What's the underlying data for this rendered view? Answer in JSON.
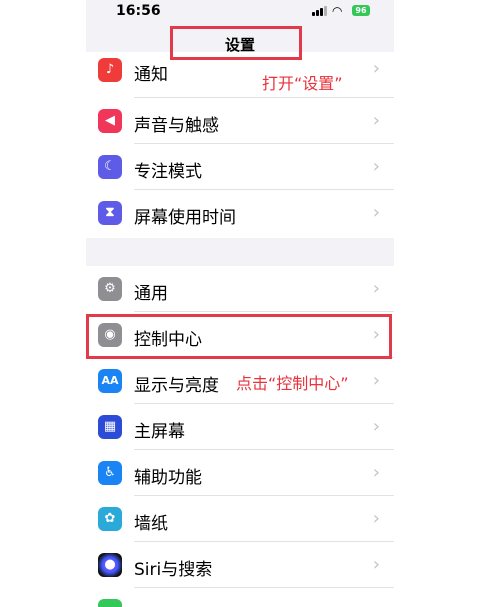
{
  "status_bar": {
    "time": "16:56",
    "battery": "96"
  },
  "nav": {
    "title": "设置"
  },
  "rows": {
    "notifications": {
      "label": "通知",
      "icon": "bell-icon",
      "color": "#ef3b3a"
    },
    "sounds": {
      "label": "声音与触感",
      "icon": "speaker-icon",
      "color": "#f0375a"
    },
    "focus": {
      "label": "专注模式",
      "icon": "moon-icon",
      "color": "#5e5ce6"
    },
    "screen_time": {
      "label": "屏幕使用时间",
      "icon": "hourglass-icon",
      "color": "#5e5ce6"
    },
    "general": {
      "label": "通用",
      "icon": "gear-icon",
      "color": "#8e8e93"
    },
    "control_center": {
      "label": "控制中心",
      "icon": "toggle-icon",
      "color": "#8e8e93"
    },
    "display": {
      "label": "显示与亮度",
      "icon": "aa-icon",
      "color": "#1b84f4"
    },
    "home_screen": {
      "label": "主屏幕",
      "icon": "grid-icon",
      "color": "#2c4bd6"
    },
    "accessibility": {
      "label": "辅助功能",
      "icon": "accessibility-icon",
      "color": "#1b84f4"
    },
    "wallpaper": {
      "label": "墙纸",
      "icon": "flower-icon",
      "color": "#2ba9d8"
    },
    "siri": {
      "label": "Siri与搜索",
      "icon": "siri-icon",
      "color": "#222222"
    }
  },
  "annotations": {
    "open_settings": "打开“设置”",
    "tap_control_center": "点击“控制中心”"
  },
  "colors": {
    "highlight_box": "#e23a4a",
    "annotation_text": "#e8323c"
  }
}
